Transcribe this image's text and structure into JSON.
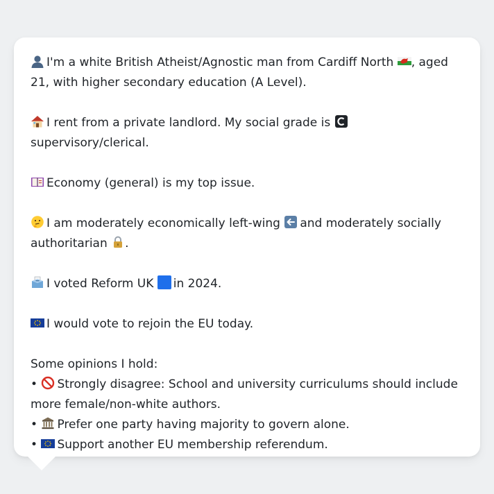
{
  "bio": {
    "identity": {
      "text_before": "I'm a white British Atheist/Agnostic man from Cardiff North",
      "text_after": ", aged 21, with higher secondary education (A Level).",
      "icon": "person-silhouette-icon",
      "flag_icon": "wales-flag-icon"
    },
    "housing": {
      "text_before": "I rent from a private landlord. My social grade is",
      "text_after": "supervisory/clerical.",
      "icon": "house-icon",
      "grade_icon": "letter-c-icon"
    },
    "issue": {
      "text": "Economy (general) is my top issue.",
      "icon": "ledger-icon"
    },
    "ideology": {
      "text_before": "I am moderately economically left-wing",
      "text_middle": "and moderately socially authoritarian",
      "text_after": ".",
      "icon": "thinking-face-icon",
      "left_icon": "left-arrow-icon",
      "lock_icon": "lock-icon"
    },
    "vote": {
      "text_before": "I voted Reform UK",
      "text_after": "in 2024.",
      "icon": "ballot-box-icon",
      "party_icon": "blue-square-icon"
    },
    "eu": {
      "text": "I would vote to rejoin the EU today.",
      "icon": "eu-flag-icon"
    }
  },
  "opinions": {
    "heading": "Some opinions I hold:",
    "items": [
      {
        "bullet": "•",
        "icon": "no-entry-icon",
        "text": "Strongly disagree: School and university curriculums should include more female/non-white authors."
      },
      {
        "bullet": "•",
        "icon": "classical-building-icon",
        "text": "Prefer one party having majority to govern alone."
      },
      {
        "bullet": "•",
        "icon": "eu-flag-icon",
        "text": "Support another EU membership referendum."
      }
    ]
  },
  "colors": {
    "background": "#eef0f2",
    "bubble": "#ffffff",
    "text": "#1f2328",
    "party_blue": "#1f6feb",
    "eu_blue": "#153d99",
    "eu_stars": "#f5c400"
  }
}
